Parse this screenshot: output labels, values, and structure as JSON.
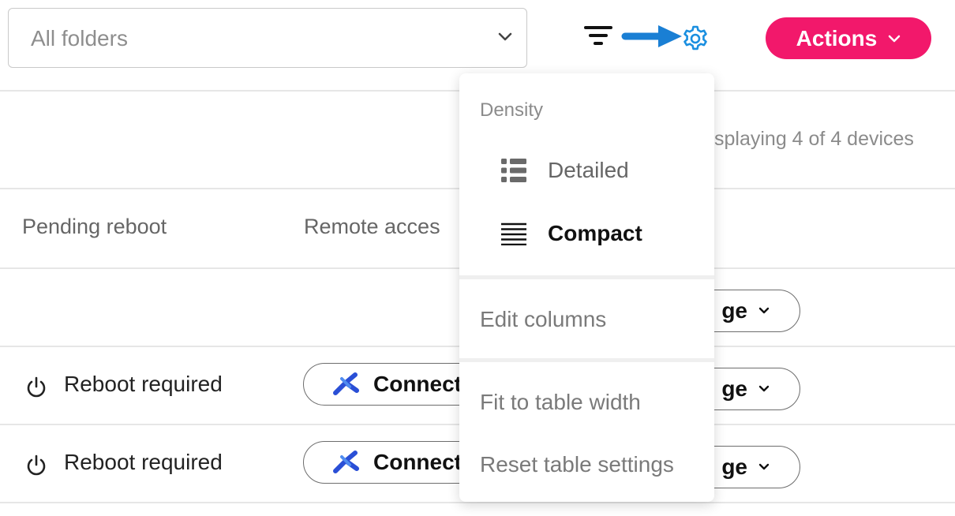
{
  "toolbar": {
    "folder_select_value": "All folders",
    "actions_label": "Actions",
    "filter_icon": "filter-icon",
    "settings_icon": "gear-icon",
    "annotation_arrow_color": "#1a7fd4",
    "accent_color": "#f2186b"
  },
  "summary": {
    "device_count_text": "splaying 4 of 4 devices"
  },
  "table": {
    "columns": [
      {
        "label": "Pending reboot"
      },
      {
        "label": "Remote acces"
      }
    ],
    "rows": [
      {
        "manage_label": "ge"
      },
      {
        "reboot_status": "Reboot required",
        "connect_label": "Connect",
        "manage_label": "ge"
      },
      {
        "reboot_status": "Reboot required",
        "connect_label": "Connect",
        "manage_label": "ge"
      }
    ]
  },
  "settings_menu": {
    "density_title": "Density",
    "density_options": [
      {
        "label": "Detailed",
        "icon": "detailed-list-icon",
        "selected": false
      },
      {
        "label": "Compact",
        "icon": "compact-list-icon",
        "selected": true
      }
    ],
    "edit_columns": "Edit columns",
    "fit_to_width": "Fit to table width",
    "reset_settings": "Reset table settings"
  }
}
